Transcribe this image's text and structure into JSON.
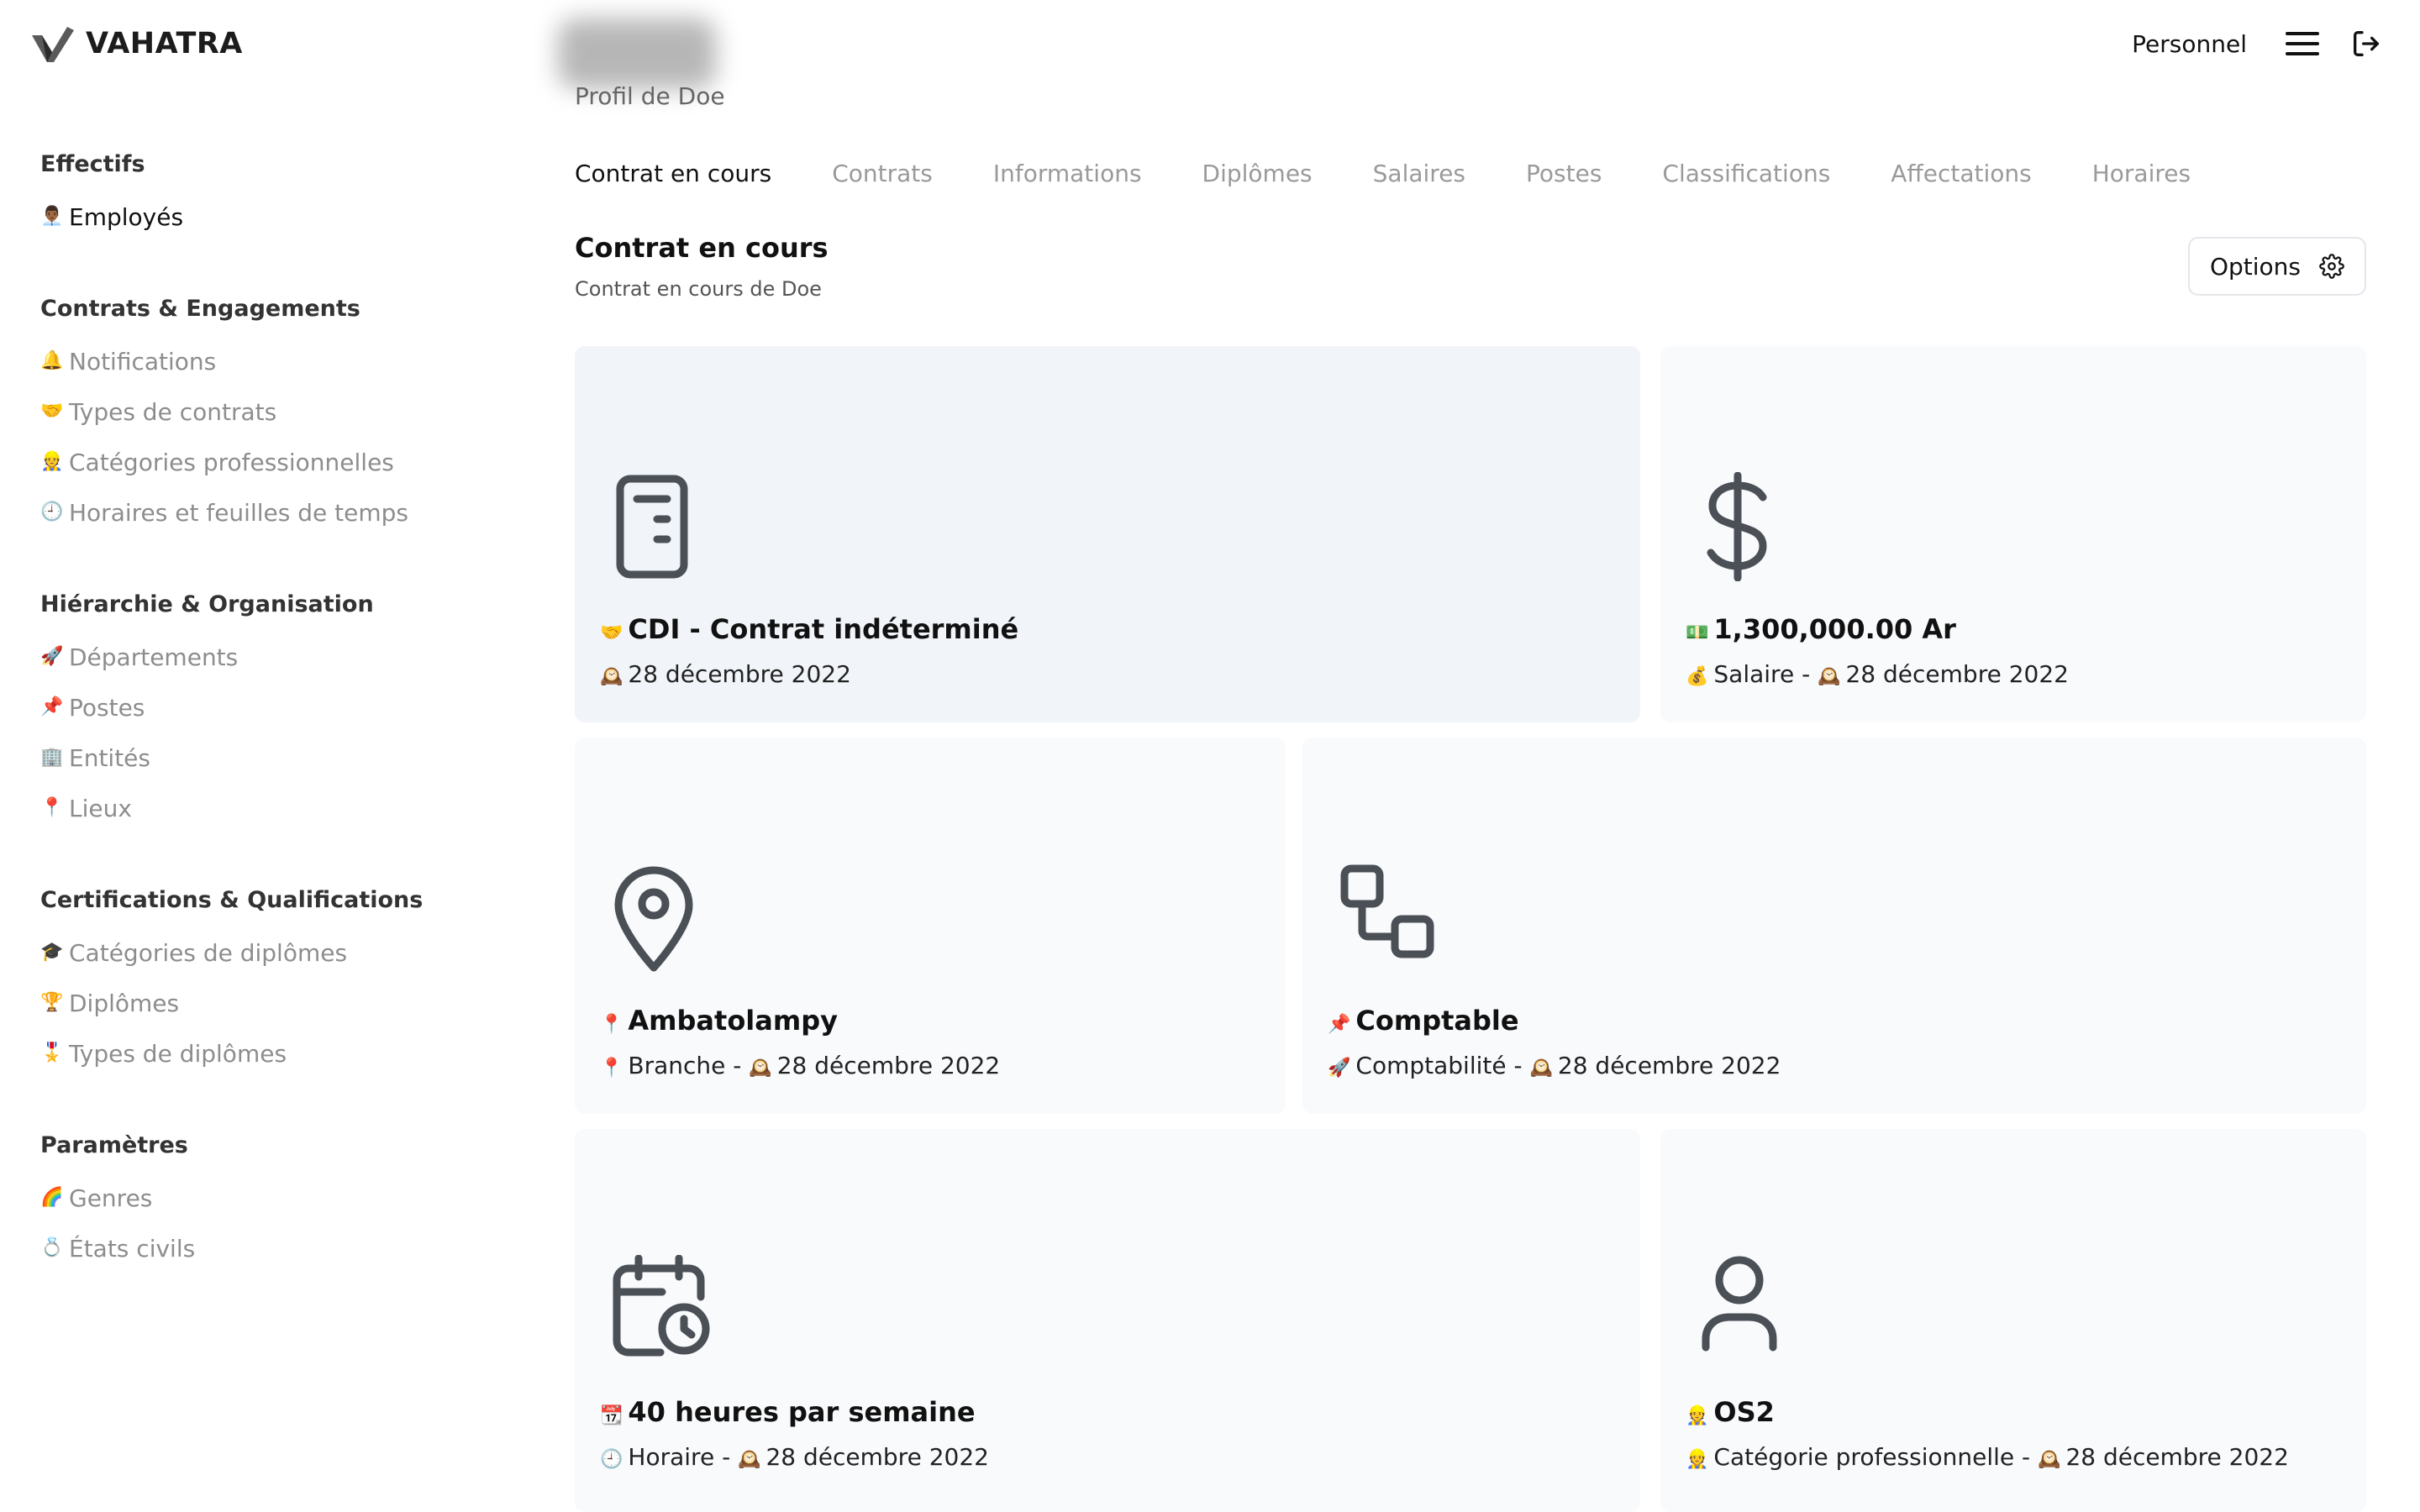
{
  "header": {
    "brand": "VAHATRA",
    "personnel_link": "Personnel",
    "profile_title": "Profil de Doe"
  },
  "sidebar": {
    "sections": [
      {
        "heading": "Effectifs",
        "items": [
          {
            "emoji": "👨🏾‍💼",
            "label": "Employés",
            "active": true
          }
        ]
      },
      {
        "heading": "Contrats & Engagements",
        "items": [
          {
            "emoji": "🔔",
            "label": "Notifications"
          },
          {
            "emoji": "🤝",
            "label": "Types de contrats"
          },
          {
            "emoji": "👷",
            "label": "Catégories professionnelles"
          },
          {
            "emoji": "🕘",
            "label": "Horaires et feuilles de temps"
          }
        ]
      },
      {
        "heading": "Hiérarchie & Organisation",
        "items": [
          {
            "emoji": "🚀",
            "label": "Départements"
          },
          {
            "emoji": "📌",
            "label": "Postes"
          },
          {
            "emoji": "🏢",
            "label": "Entités"
          },
          {
            "emoji": "📍",
            "label": "Lieux"
          }
        ]
      },
      {
        "heading": "Certifications & Qualifications",
        "items": [
          {
            "emoji": "🎓",
            "label": "Catégories de diplômes"
          },
          {
            "emoji": "🏆",
            "label": "Diplômes"
          },
          {
            "emoji": "🎖️",
            "label": "Types de diplômes"
          }
        ]
      },
      {
        "heading": "Paramètres",
        "items": [
          {
            "emoji": "🌈",
            "label": "Genres"
          },
          {
            "emoji": "💍",
            "label": "États civils"
          }
        ]
      }
    ]
  },
  "tabs": [
    {
      "label": "Contrat en cours",
      "active": true
    },
    {
      "label": "Contrats"
    },
    {
      "label": "Informations"
    },
    {
      "label": "Diplômes"
    },
    {
      "label": "Salaires"
    },
    {
      "label": "Postes"
    },
    {
      "label": "Classifications"
    },
    {
      "label": "Affectations"
    },
    {
      "label": "Horaires"
    }
  ],
  "section": {
    "title": "Contrat en cours",
    "subtitle": "Contrat en cours de Doe",
    "options_label": "Options"
  },
  "cards": {
    "contract": {
      "title_emoji": "🤝",
      "title": "CDI - Contrat indéterminé",
      "date_emoji": "🕰️",
      "date": "28 décembre 2022"
    },
    "salary": {
      "title_emoji": "💵",
      "title": "1,300,000.00 Ar",
      "sub_emoji": "💰",
      "sub_label": "Salaire -",
      "date_emoji": "🕰️",
      "date": "28 décembre 2022"
    },
    "location": {
      "title_emoji": "📍",
      "title": "Ambatolampy",
      "sub_emoji": "📍",
      "sub_label": "Branche -",
      "date_emoji": "🕰️",
      "date": "28 décembre 2022"
    },
    "position": {
      "title_emoji": "📌",
      "title": "Comptable",
      "sub_emoji": "🚀",
      "sub_label": "Comptabilité -",
      "date_emoji": "🕰️",
      "date": "28 décembre 2022"
    },
    "schedule": {
      "title_emoji": "📆",
      "title": "40 heures par semaine",
      "sub_emoji": "🕘",
      "sub_label": "Horaire -",
      "date_emoji": "🕰️",
      "date": "28 décembre 2022"
    },
    "category": {
      "title_emoji": "👷",
      "title": "OS2",
      "sub_emoji": "👷",
      "sub_label": "Catégorie professionnelle -",
      "date_emoji": "🕰️",
      "date": "28 décembre 2022"
    }
  },
  "colors": {
    "muted_text": "#8d8d8d",
    "card_bg": "#f8fafc",
    "card_highlight_bg": "#f1f4f9",
    "icon_stroke": "#4b4f56"
  }
}
